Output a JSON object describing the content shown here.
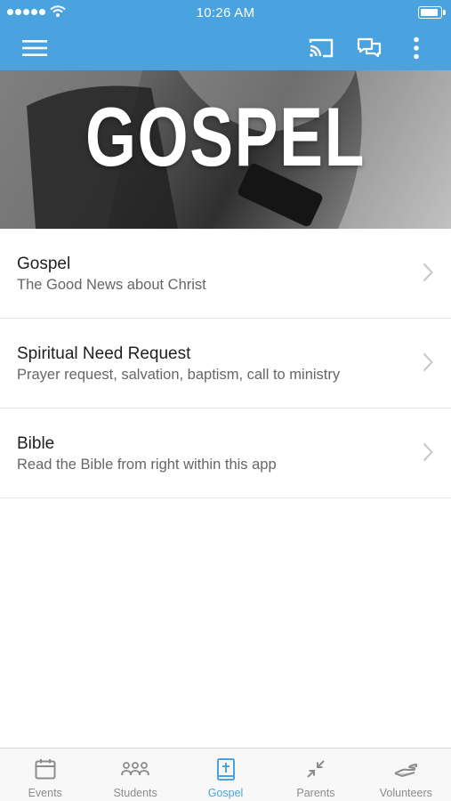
{
  "status_bar": {
    "time": "10:26 AM"
  },
  "app_bar": {
    "color": "#4aa3df",
    "icons": [
      "menu-icon",
      "cast-icon",
      "chat-icon",
      "more-vertical-icon"
    ]
  },
  "hero": {
    "title": "GOSPEL"
  },
  "list": {
    "items": [
      {
        "title": "Gospel",
        "subtitle": "The Good News about Christ"
      },
      {
        "title": "Spiritual Need Request",
        "subtitle": "Prayer request, salvation, baptism, call to ministry"
      },
      {
        "title": "Bible",
        "subtitle": "Read the Bible from right within this app"
      }
    ]
  },
  "tab_bar": {
    "active_color": "#4aa3df",
    "tabs": [
      {
        "label": "Events",
        "icon": "calendar-icon"
      },
      {
        "label": "Students",
        "icon": "people-icon"
      },
      {
        "label": "Gospel",
        "icon": "bible-icon",
        "active": true
      },
      {
        "label": "Parents",
        "icon": "compress-icon"
      },
      {
        "label": "Volunteers",
        "icon": "helping-hand-icon"
      }
    ]
  }
}
